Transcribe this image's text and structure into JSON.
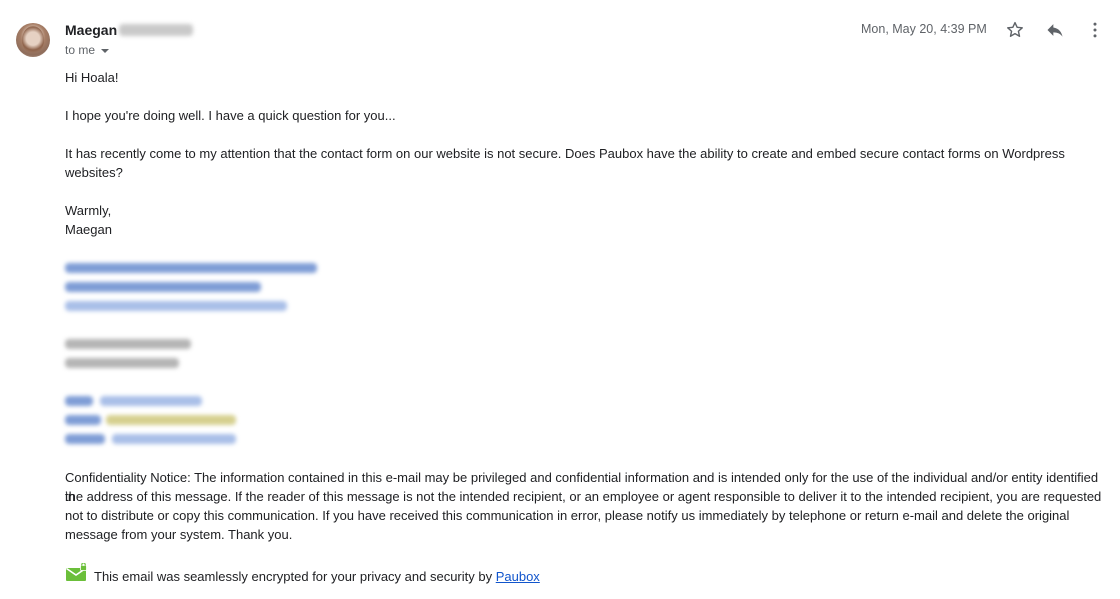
{
  "header": {
    "sender_name": "Maegan",
    "recipient": "to me",
    "date": "Mon, May 20, 4:39 PM"
  },
  "body": {
    "greeting": "Hi Hoala!",
    "line1": "I hope you're doing well. I have a quick question for you...",
    "line2a": "It has recently come to my attention that the contact form on our website is not secure. Does Paubox have the ability to create and embed secure contact forms on Wordpress",
    "line2b": "websites?",
    "signoff": "Warmly,",
    "signature_name": "Maegan",
    "notice_lines": [
      "Confidentiality Notice: The information contained in this e-mail may be privileged and confidential information and is intended only for the use of the individual and/or entity identified in",
      "the address of this message. If the reader of this message is not the intended recipient, or an employee or agent responsible to deliver it to the intended recipient, you are requested",
      "not to distribute or copy this communication. If you have received this communication in error, please notify us immediately by telephone or return e-mail and delete the original",
      "message from your system. Thank you."
    ]
  },
  "footer": {
    "text": "This email was seamlessly encrypted for your privacy and security by ",
    "link_label": "Paubox"
  },
  "icons": {
    "star": "star-icon",
    "reply": "reply-icon",
    "more": "more-vert-icon",
    "dropdown": "chevron-down-icon",
    "logo": "paubox-logo-icon"
  }
}
